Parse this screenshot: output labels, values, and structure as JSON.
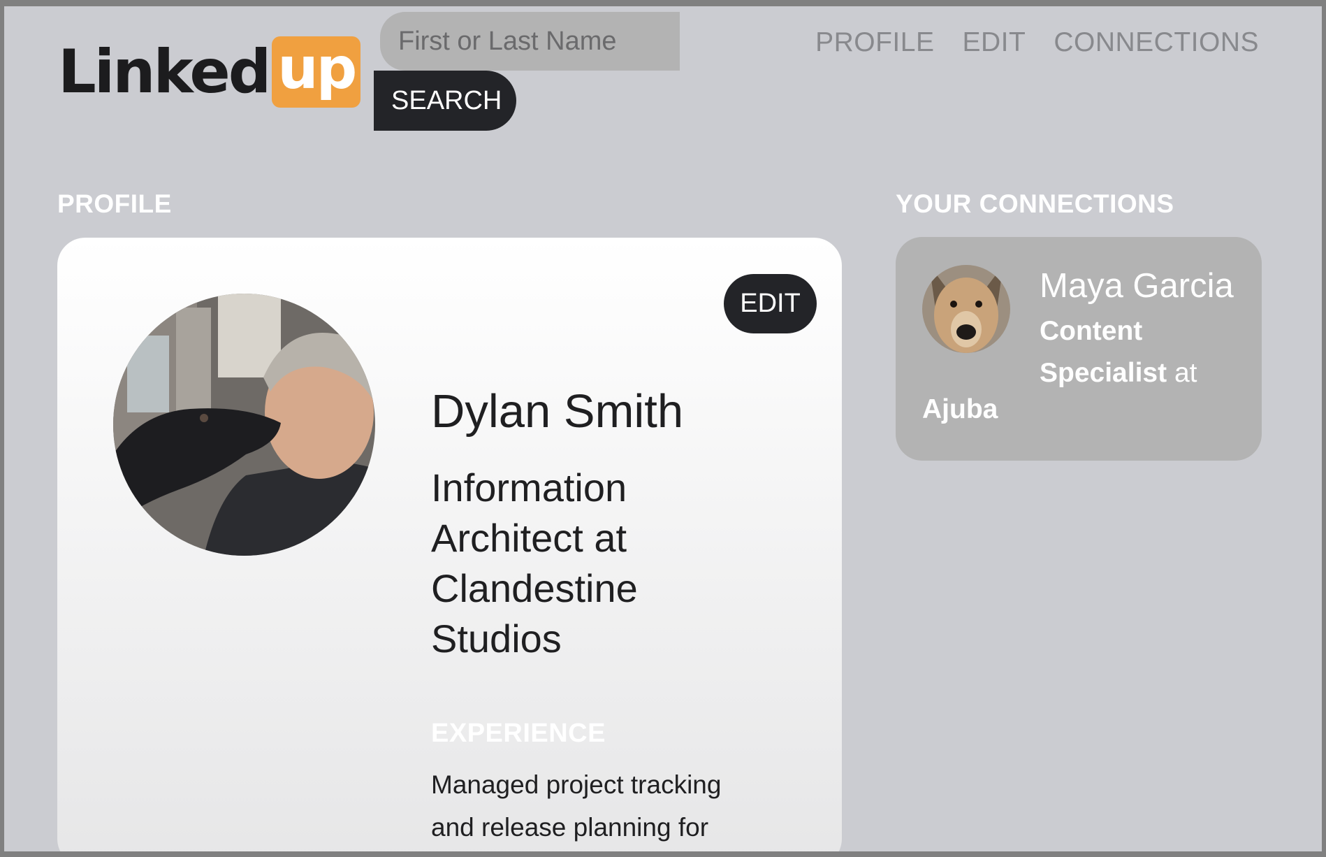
{
  "header": {
    "logo": {
      "main": "Linked",
      "badge": "up"
    },
    "search": {
      "placeholder": "First or Last Name",
      "button_label": "SEARCH"
    },
    "nav": [
      {
        "label": "PROFILE"
      },
      {
        "label": "EDIT"
      },
      {
        "label": "CONNECTIONS"
      }
    ]
  },
  "profile": {
    "section_title": "PROFILE",
    "edit_label": "EDIT",
    "name": "Dylan Smith",
    "title": "Information Architect at Clandestine Studios",
    "experience_heading": "EXPERIENCE",
    "experience_text": "Managed project tracking and release planning for"
  },
  "connections": {
    "section_title": "YOUR CONNECTIONS",
    "items": [
      {
        "name": "Maya Garcia",
        "role": "Content Specialist",
        "at": "at",
        "company": "Ajuba"
      }
    ]
  },
  "colors": {
    "background": "#cbccd1",
    "accent": "#f0a040",
    "dark_button": "#232428",
    "card": "#ffffff",
    "connection_card": "#b3b3b3"
  }
}
